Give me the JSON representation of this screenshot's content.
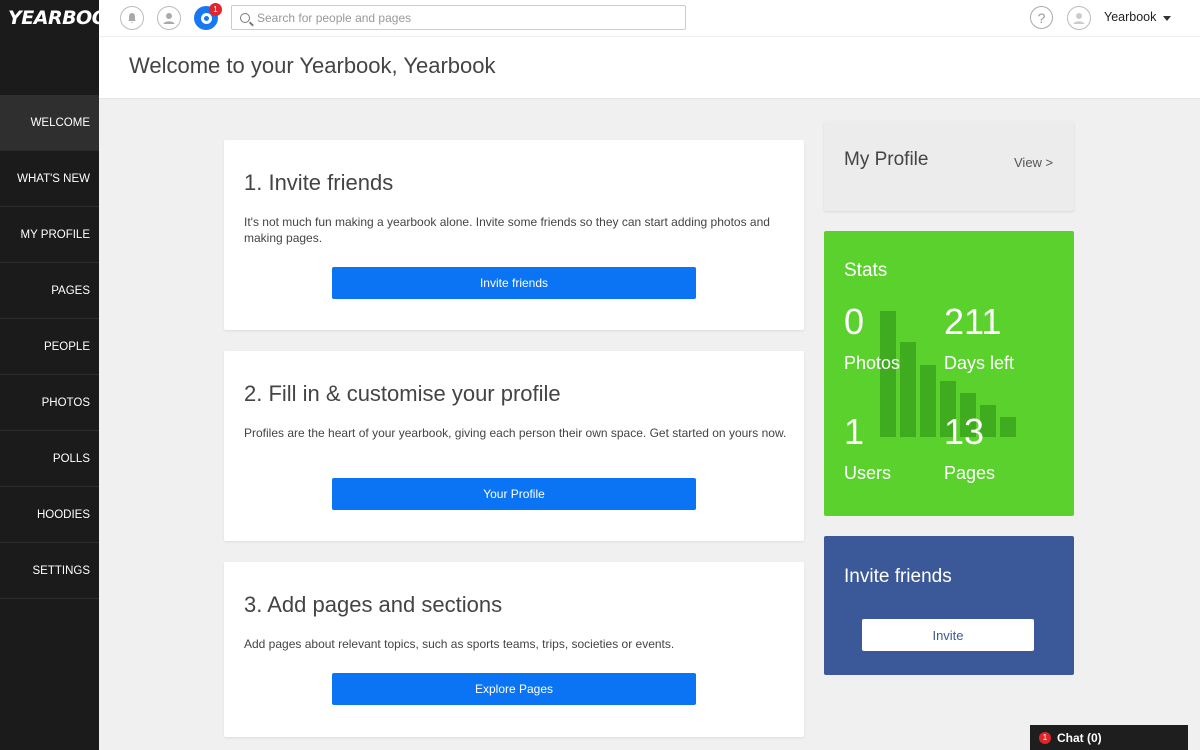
{
  "app": {
    "logo": "YEARBOOK"
  },
  "sidebar": {
    "items": [
      {
        "label": "WELCOME"
      },
      {
        "label": "WHAT'S NEW"
      },
      {
        "label": "MY PROFILE"
      },
      {
        "label": "PAGES"
      },
      {
        "label": "PEOPLE"
      },
      {
        "label": "PHOTOS"
      },
      {
        "label": "POLLS"
      },
      {
        "label": "HOODIES"
      },
      {
        "label": "SETTINGS"
      }
    ],
    "active": "WELCOME"
  },
  "topbar": {
    "notification_count": "1",
    "search_placeholder": "Search for people and pages",
    "help_glyph": "?",
    "username": "Yearbook"
  },
  "header": {
    "title": "Welcome to your Yearbook, Yearbook"
  },
  "steps": [
    {
      "title": "1. Invite friends",
      "text": "It's not much fun making a yearbook alone. Invite some friends so they can start adding photos and making pages.",
      "button": "Invite friends"
    },
    {
      "title": "2. Fill in & customise your profile",
      "text": "Profiles are the heart of your yearbook, giving each person their own space. Get started on yours now.",
      "button": "Your Profile"
    },
    {
      "title": "3. Add pages and sections",
      "text": "Add pages about relevant topics, such as sports teams, trips, societies or events.",
      "button": "Explore Pages"
    }
  ],
  "profile_card": {
    "title": "My Profile",
    "link": "View >"
  },
  "stats": {
    "title": "Stats",
    "photos": {
      "value": "0",
      "label": "Photos"
    },
    "days_left": {
      "value": "211",
      "label": "Days left"
    },
    "users": {
      "value": "1",
      "label": "Users"
    },
    "pages": {
      "value": "13",
      "label": "Pages"
    }
  },
  "invite_card": {
    "title": "Invite friends",
    "button": "Invite"
  },
  "chat": {
    "badge": "1",
    "label": "Chat (0)"
  },
  "colors": {
    "primary_button": "#0a74f5",
    "stats_bg": "#5bd12e",
    "invite_bg": "#3b5998",
    "sidebar_bg": "#1b1b1b"
  }
}
